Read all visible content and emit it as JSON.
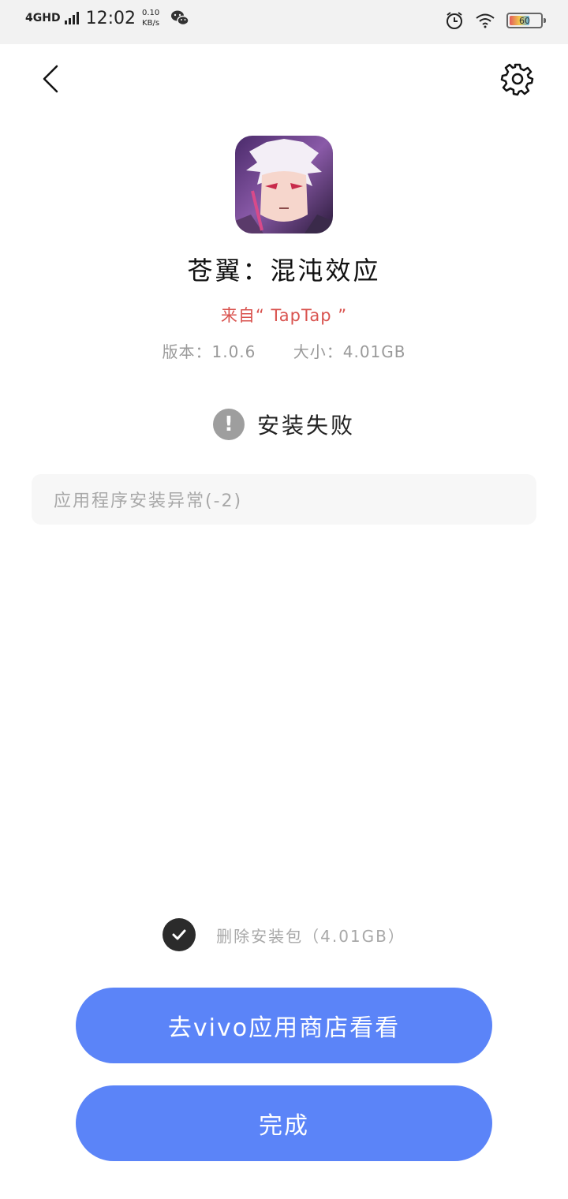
{
  "status_bar": {
    "network": "4GHD",
    "time": "12:02",
    "speed_value": "0.10",
    "speed_unit": "KB/s",
    "battery_level": "60",
    "icons": [
      "signal-icon",
      "wechat-icon",
      "alarm-icon",
      "wifi-icon",
      "battery-icon"
    ]
  },
  "header": {
    "back_icon": "chevron-left-icon",
    "settings_icon": "gear-icon"
  },
  "app": {
    "name": "苍翼：混沌效应",
    "source": "来自“ TapTap ”",
    "version": "版本：1.0.6",
    "size": "大小：4.01GB"
  },
  "install_status": {
    "icon": "warning-icon",
    "text": "安装失败"
  },
  "error_message": "应用程序安装异常(-2)",
  "delete_option": {
    "checked": true,
    "label": "删除安装包（4.01GB）"
  },
  "buttons": {
    "store_label": "去vivo应用商店看看",
    "done_label": "完成"
  },
  "colors": {
    "accent": "#5b84f8",
    "source_text": "#d9534f",
    "warning_icon": "#9e9e9e"
  }
}
